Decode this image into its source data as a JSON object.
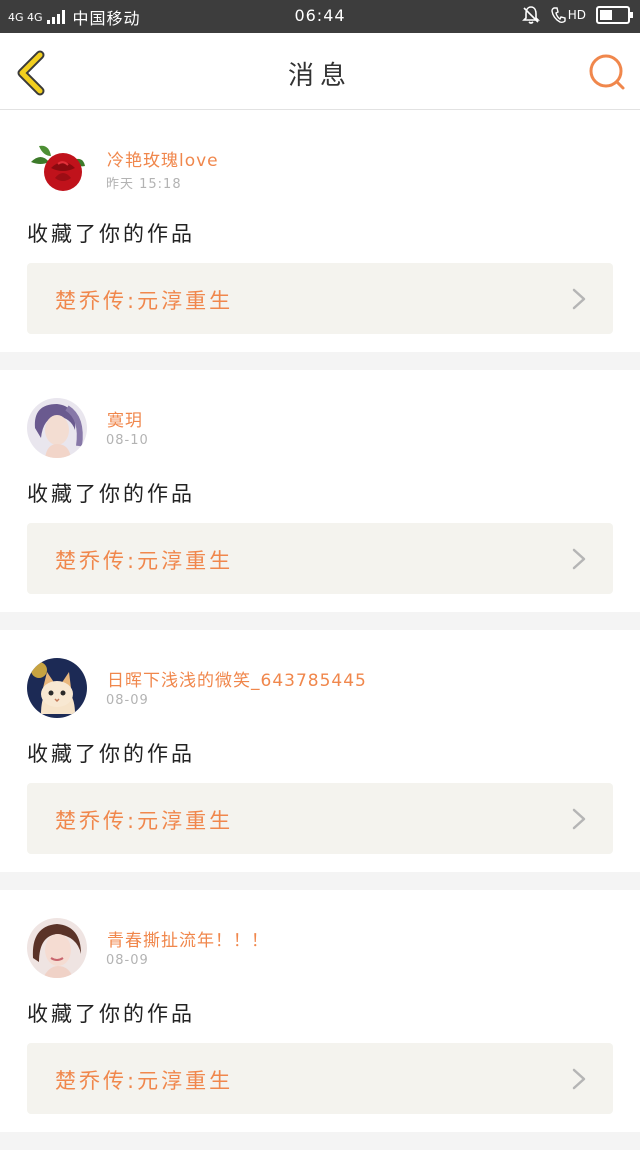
{
  "status_bar": {
    "network": "4G 4G",
    "carrier": "中国移动",
    "time": "06:44",
    "hd": "HD",
    "battery_level": 0.45
  },
  "header": {
    "title": "消息",
    "back_icon": "chevron-left-icon",
    "search_icon": "search-icon",
    "accent_color": "#f0874c",
    "back_color": "#f2cf1e"
  },
  "messages": [
    {
      "username": "冷艳玫瑰love",
      "timestamp": "昨天 15:18",
      "action": "收藏了你的作品",
      "work_title": "楚乔传:元淳重生",
      "avatar": "rose-avatar"
    },
    {
      "username": "寞玥",
      "timestamp": "08-10",
      "action": "收藏了你的作品",
      "work_title": "楚乔传:元淳重生",
      "avatar": "girl-purple-hair-avatar"
    },
    {
      "username": "日晖下浅浅的微笑_643785445",
      "timestamp": "08-09",
      "action": "收藏了你的作品",
      "work_title": "楚乔传:元淳重生",
      "avatar": "cat-avatar"
    },
    {
      "username": "青春撕扯流年！！！",
      "timestamp": "08-09",
      "action": "收藏了你的作品",
      "work_title": "楚乔传:元淳重生",
      "avatar": "girl-portrait-avatar"
    }
  ]
}
